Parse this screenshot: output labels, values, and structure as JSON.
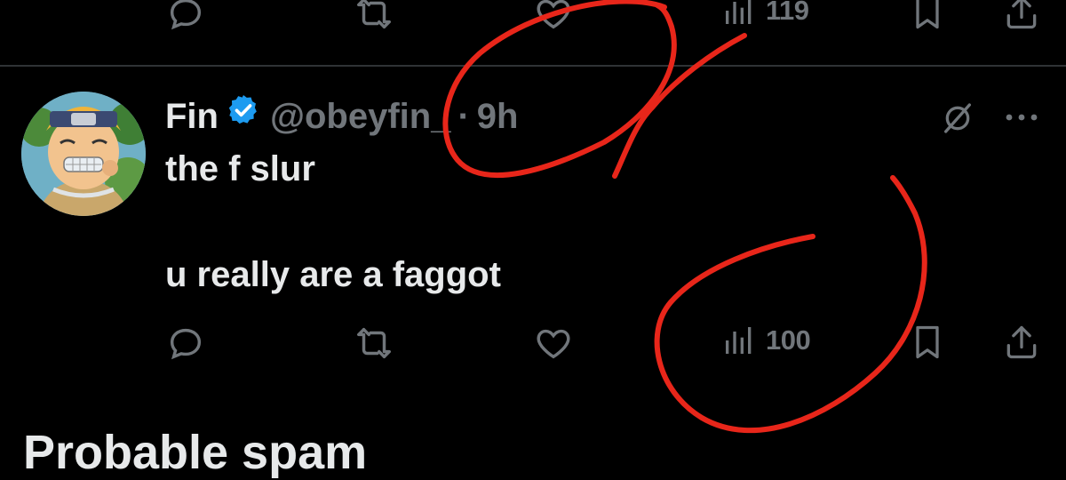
{
  "previous_tweet": {
    "views_count": "119"
  },
  "tweet": {
    "display_name": "Fin",
    "handle": "@obeyfin_",
    "separator": "·",
    "timestamp": "9h",
    "text_line1": "the f slur",
    "text_line2": "u really are a faggot",
    "views_count": "100"
  },
  "section": {
    "title": "Probable spam"
  },
  "colors": {
    "background": "#000000",
    "text": "#e7e9ea",
    "muted": "#71767b",
    "verified": "#1d9bf0",
    "annotation": "#e8261a"
  },
  "icons": [
    "reply-icon",
    "repost-icon",
    "like-icon",
    "views-icon",
    "bookmark-icon",
    "share-icon",
    "grok-icon",
    "more-icon",
    "verified-badge-icon"
  ]
}
